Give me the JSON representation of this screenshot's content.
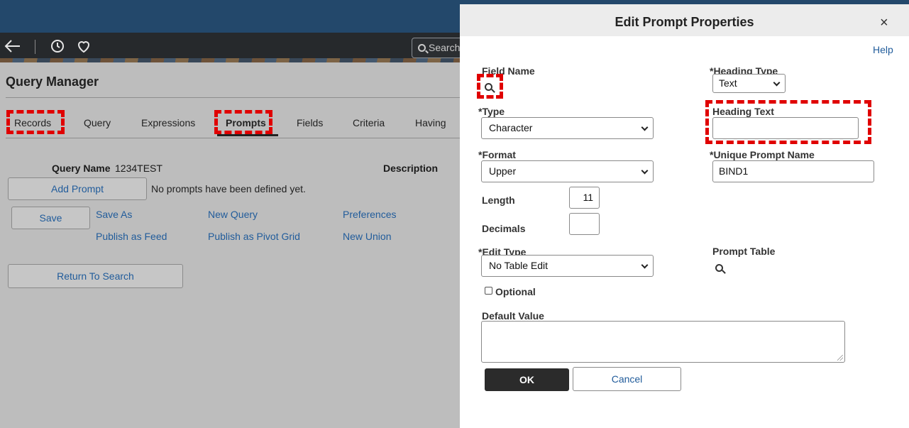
{
  "background": {
    "search_placeholder": "Search",
    "page_title": "Query Manager",
    "tabs": [
      {
        "label": "Records"
      },
      {
        "label": "Query"
      },
      {
        "label": "Expressions"
      },
      {
        "label": "Prompts"
      },
      {
        "label": "Fields"
      },
      {
        "label": "Criteria"
      },
      {
        "label": "Having"
      }
    ],
    "active_tab": "Prompts",
    "query_name_label": "Query Name",
    "query_name_value": "1234TEST",
    "description_label": "Description",
    "add_prompt_label": "Add Prompt",
    "no_prompts_text": "No prompts have been defined yet.",
    "save_label": "Save",
    "links": {
      "save_as": "Save As",
      "new_query": "New Query",
      "preferences": "Preferences",
      "publish_as_feed": "Publish as Feed",
      "publish_as_pivot_grid": "Publish as Pivot Grid",
      "new_union": "New Union"
    },
    "return_to_search_label": "Return To Search"
  },
  "modal": {
    "title": "Edit Prompt Properties",
    "close_glyph": "×",
    "help_label": "Help",
    "field_name_label": "Field Name",
    "heading_type_label": "*Heading Type",
    "heading_type_value": "Text",
    "type_label": "*Type",
    "type_value": "Character",
    "heading_text_label": "Heading Text",
    "heading_text_value": "",
    "format_label": "*Format",
    "format_value": "Upper",
    "unique_prompt_name_label": "*Unique Prompt Name",
    "unique_prompt_name_value": "BIND1",
    "length_label": "Length",
    "length_value": "11",
    "decimals_label": "Decimals",
    "decimals_value": "",
    "edit_type_label": "*Edit Type",
    "edit_type_value": "No Table Edit",
    "prompt_table_label": "Prompt Table",
    "optional_label": "Optional",
    "optional_checked": false,
    "default_value_label": "Default Value",
    "default_value": "",
    "ok_label": "OK",
    "cancel_label": "Cancel"
  },
  "colors": {
    "header_blue": "#23486b",
    "link_blue": "#215c9b",
    "highlight_red": "#e00000",
    "ok_button": "#2b2b2b"
  },
  "icons": [
    "back-arrow-icon",
    "history-icon",
    "favorite-heart-icon",
    "search-icon",
    "close-icon",
    "lookup-icon",
    "chevron-down-icon"
  ]
}
